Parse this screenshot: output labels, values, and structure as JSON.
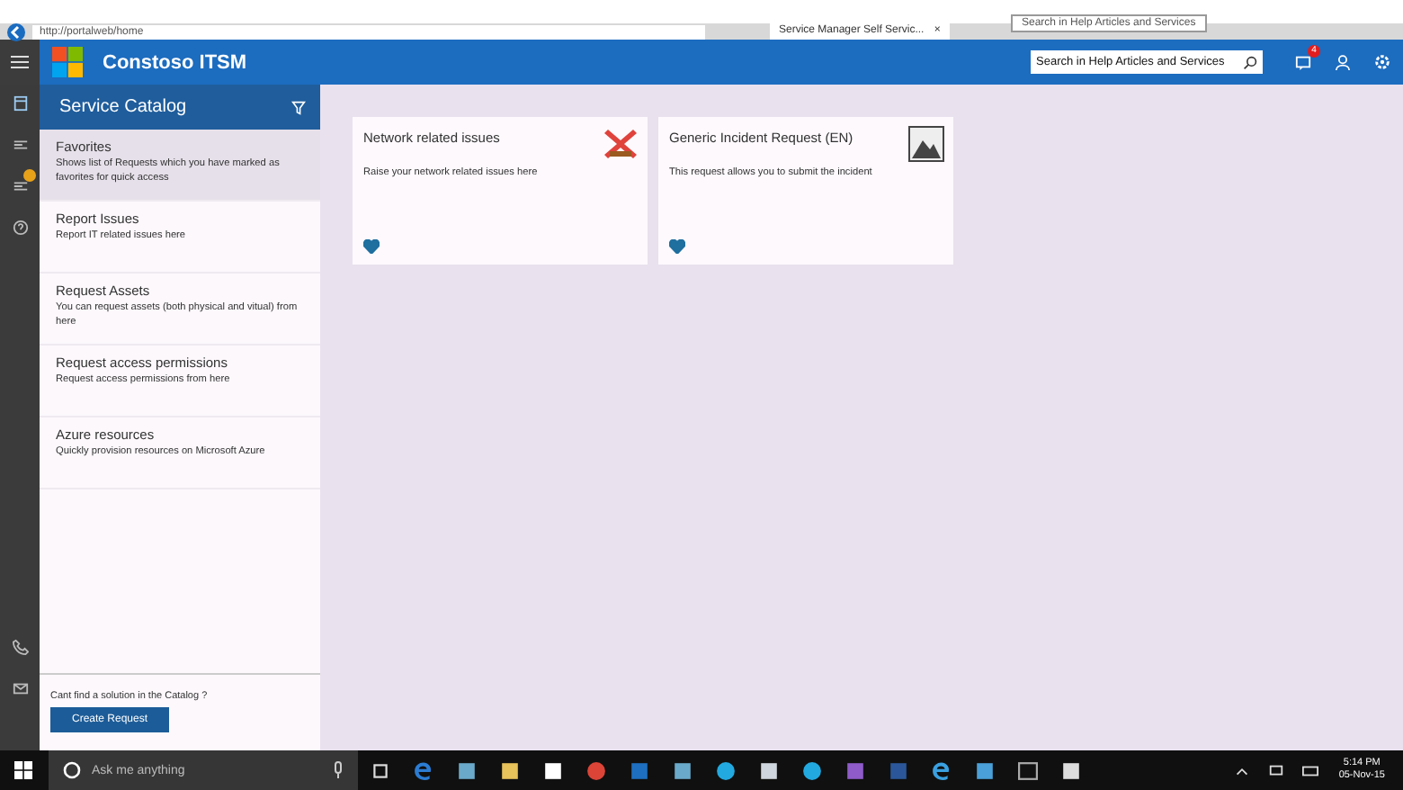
{
  "browser": {
    "address": "http://portalweb/home",
    "tab_title": "Service Manager Self Servic...",
    "tab_close": "×",
    "tooltip": "Search in Help Articles and Services"
  },
  "header": {
    "app_title": "Constoso ITSM",
    "search_value": "Search in Help Articles and Services",
    "notification_count": "4"
  },
  "catalog": {
    "title": "Service Catalog",
    "items": [
      {
        "title": "Favorites",
        "description": "Shows list of Requests which you have marked as favorites for quick access",
        "selected": true
      },
      {
        "title": "Report Issues",
        "description": "Report IT related issues here",
        "selected": false
      },
      {
        "title": "Request Assets",
        "description": "You can request assets (both physical and vitual) from here",
        "selected": false
      },
      {
        "title": "Request access permissions",
        "description": "Request access permissions from here",
        "selected": false
      },
      {
        "title": "Azure resources",
        "description": "Quickly provision resources on Microsoft Azure",
        "selected": false
      }
    ],
    "footer_prompt": "Cant find a solution in the Catalog ?",
    "footer_button": "Create Request"
  },
  "cards": [
    {
      "title": "Network related issues",
      "description": "Raise your network related issues here",
      "kind": "network",
      "favorite": true
    },
    {
      "title": "Generic Incident Request (EN)",
      "description": "This request allows you to submit the incident",
      "kind": "generic",
      "favorite": true
    }
  ],
  "taskbar": {
    "search_placeholder": "Ask me anything",
    "time": "5:14 PM",
    "date": "05-Nov-15"
  }
}
